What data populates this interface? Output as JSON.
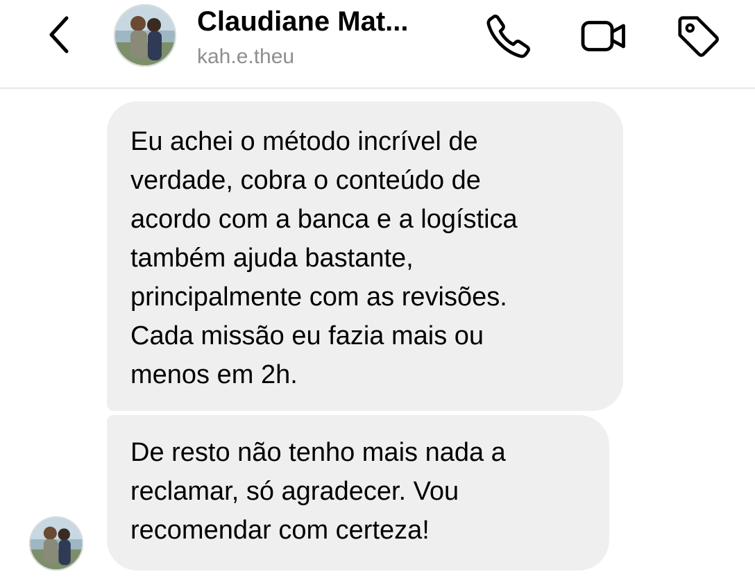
{
  "header": {
    "display_name": "Claudiane  Mat...",
    "username": "kah.e.theu",
    "icons": {
      "back": "chevron-left-icon",
      "call": "phone-icon",
      "video": "video-camera-icon",
      "tag": "tag-icon",
      "avatar": "profile-photo"
    }
  },
  "messages": [
    {
      "text": "Eu achei o método incrível de\nverdade, cobra o conteúdo de\nacordo com a banca e a logística\ntambém ajuda bastante,\nprincipalmente com as revisões.\nCada missão eu fazia mais ou\nmenos em 2h."
    },
    {
      "text": "De resto não tenho mais nada a\nreclamar, só agradecer. Vou\nrecomendar com certeza!"
    }
  ],
  "colors": {
    "bubble_bg": "#efefef",
    "text": "#000000",
    "secondary_text": "#8e8e8e",
    "divider": "#e6e6e6"
  }
}
